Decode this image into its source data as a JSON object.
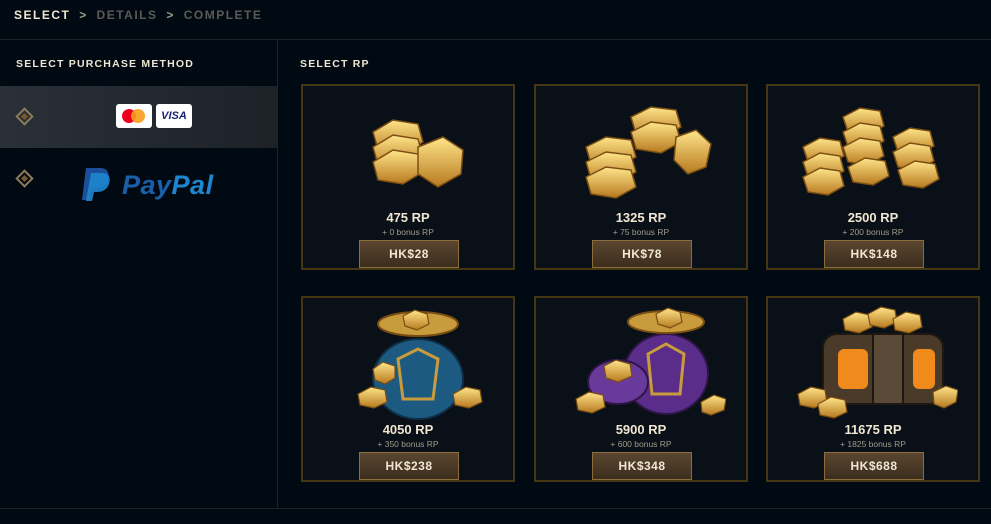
{
  "breadcrumb": {
    "step1": "SELECT",
    "sep1": ">",
    "step2": "DETAILS",
    "sep2": ">",
    "step3": "COMPLETE"
  },
  "left_panel": {
    "title": "SELECT PURCHASE METHOD",
    "methods": [
      {
        "name": "card",
        "visa_label": "VISA",
        "selected": true
      },
      {
        "name": "paypal",
        "logo_text_a": "Pay",
        "logo_text_b": "Pal",
        "selected": false
      }
    ]
  },
  "main": {
    "title": "SELECT RP",
    "packages": [
      {
        "rp": "475 RP",
        "bonus": "+ 0 bonus RP",
        "price": "HK$28",
        "art": "small-rp-stack"
      },
      {
        "rp": "1325 RP",
        "bonus": "+ 75 bonus RP",
        "price": "HK$78",
        "art": "medium-rp-stack"
      },
      {
        "rp": "2500 RP",
        "bonus": "+ 200 bonus RP",
        "price": "HK$148",
        "art": "large-rp-stack"
      },
      {
        "rp": "4050 RP",
        "bonus": "+ 350 bonus RP",
        "price": "HK$238",
        "art": "blue-rp-bag"
      },
      {
        "rp": "5900 RP",
        "bonus": "+ 600 bonus RP",
        "price": "HK$348",
        "art": "purple-rp-bag"
      },
      {
        "rp": "11675 RP",
        "bonus": "+ 1825 bonus RP",
        "price": "HK$688",
        "art": "rp-chest"
      }
    ]
  },
  "colors": {
    "background": "#010a13",
    "gold_border": "#463714",
    "gold_text": "#f0e6d2",
    "muted_text": "#a09b8c",
    "price_button": "#4a3a27"
  }
}
